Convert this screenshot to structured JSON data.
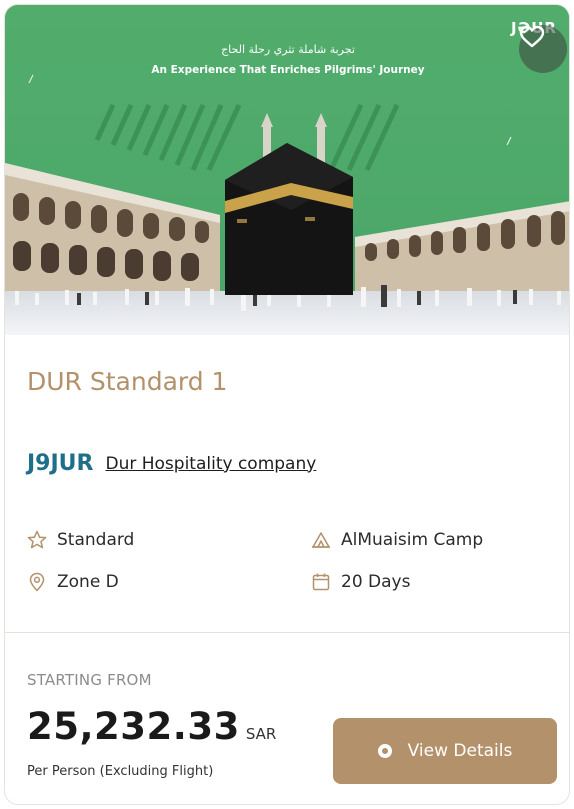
{
  "hero": {
    "arabic_tagline": "تجربة شاملة تثري رحلة الحاج",
    "english_tagline": "An Experience That Enriches Pilgrims' Journey",
    "brand_mark": "JƏUR"
  },
  "package": {
    "title": "DUR Standard 1"
  },
  "company": {
    "logo_text": "J9JUR",
    "name": "Dur Hospitality company"
  },
  "features": {
    "category": "Standard",
    "camp": "AlMuaisim Camp",
    "zone": "Zone D",
    "duration": "20 Days"
  },
  "pricing": {
    "label": "STARTING FROM",
    "amount": "25,232.33",
    "currency": "SAR",
    "note": "Per Person (Excluding Flight)"
  },
  "actions": {
    "view_details": "View Details"
  },
  "colors": {
    "accent": "#b3916a",
    "hero_green": "#4daa6a",
    "logo_blue": "#1f6f8b"
  },
  "icons": [
    "heart-icon",
    "star-icon",
    "tent-icon",
    "location-pin-icon",
    "calendar-icon",
    "radio-dot-icon"
  ]
}
